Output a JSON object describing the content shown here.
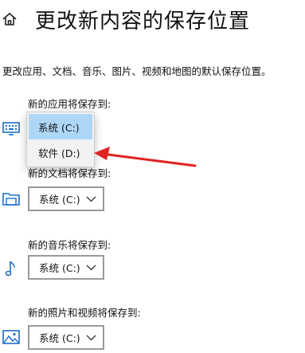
{
  "header": {
    "title": "更改新内容的保存位置",
    "home_icon": "home-icon"
  },
  "description": "更改应用、文档、音乐、图片、视频和地图的默认保存位置。",
  "sections": [
    {
      "label": "新的应用将保存到:",
      "icon": "monitor-icon",
      "value": "系统 (C:)"
    },
    {
      "label": "新的文档将保存到:",
      "icon": "folder-icon",
      "value": "系统 (C:)"
    },
    {
      "label": "新的音乐将保存到:",
      "icon": "music-note-icon",
      "value": "系统 (C:)"
    },
    {
      "label": "新的照片和视频将保存到:",
      "icon": "image-icon",
      "value": "系统 (C:)"
    }
  ],
  "dropdown_menu": {
    "options": [
      "系统 (C:)",
      "软件 (D:)"
    ],
    "selected_index": 0
  },
  "colors": {
    "accent_blue": "#1a6ec7",
    "menu_selected": "#aed7f7",
    "annotation_arrow": "#e02424"
  }
}
